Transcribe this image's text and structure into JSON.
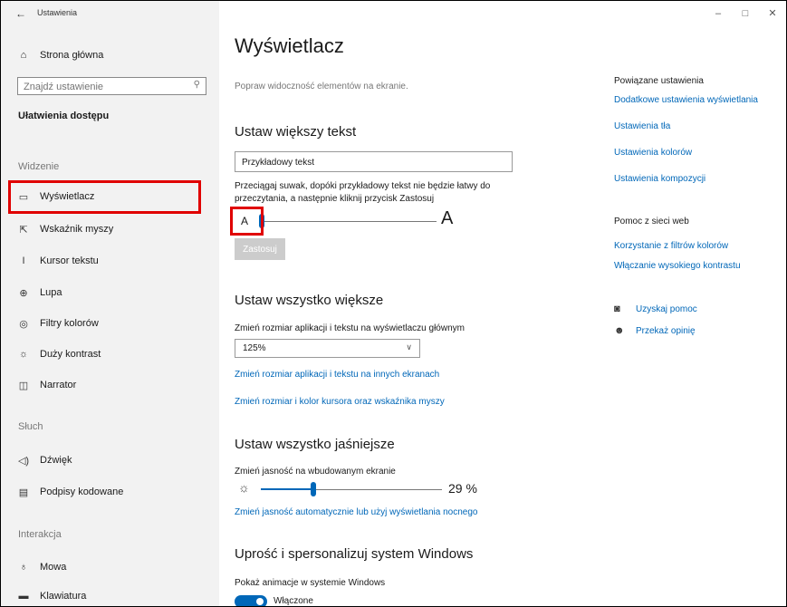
{
  "window": {
    "title": "Ustawienia",
    "back": "←",
    "controls": [
      "–",
      "□",
      "✕"
    ]
  },
  "sidebar": {
    "home": "Strona główna",
    "search_placeholder": "Znajdź ustawienie",
    "category": "Ułatwienia dostępu",
    "sections": {
      "vision": "Widzenie",
      "hearing": "Słuch",
      "interaction": "Interakcja"
    },
    "items": [
      {
        "label": "Wyświetlacz",
        "icon": "display-icon"
      },
      {
        "label": "Wskaźnik myszy",
        "icon": "mouse-pointer-icon"
      },
      {
        "label": "Kursor tekstu",
        "icon": "text-cursor-icon"
      },
      {
        "label": "Lupa",
        "icon": "magnifier-icon"
      },
      {
        "label": "Filtry kolorów",
        "icon": "color-filter-icon"
      },
      {
        "label": "Duży kontrast",
        "icon": "high-contrast-icon"
      },
      {
        "label": "Narrator",
        "icon": "narrator-icon"
      },
      {
        "label": "Dźwięk",
        "icon": "speaker-icon"
      },
      {
        "label": "Podpisy kodowane",
        "icon": "captions-icon"
      },
      {
        "label": "Mowa",
        "icon": "microphone-icon"
      },
      {
        "label": "Klawiatura",
        "icon": "keyboard-icon"
      }
    ]
  },
  "main": {
    "title": "Wyświetlacz",
    "subtitle": "Popraw widoczność elementów na ekranie.",
    "text_section": {
      "heading": "Ustaw większy tekst",
      "sample": "Przykładowy tekst",
      "instruction": "Przeciągaj suwak, dopóki przykładowy tekst nie będzie łatwy do przeczytania, a następnie kliknij przycisk Zastosuj",
      "small_a": "A",
      "big_a": "A",
      "slider_value_percent": 0,
      "apply": "Zastosuj"
    },
    "scale_section": {
      "heading": "Ustaw wszystko większe",
      "label": "Zmień rozmiar aplikacji i tekstu na wyświetlaczu głównym",
      "selected": "125%",
      "link1": "Zmień rozmiar aplikacji i tekstu na innych ekranach",
      "link2": "Zmień rozmiar i kolor kursora oraz wskaźnika myszy"
    },
    "brightness_section": {
      "heading": "Ustaw wszystko jaśniejsze",
      "label": "Zmień jasność na wbudowanym ekranie",
      "value": "29 %",
      "value_fraction": 0.29,
      "link": "Zmień jasność automatycznie lub użyj wyświetlania nocnego"
    },
    "personalize_section": {
      "heading": "Uprość i spersonalizuj system Windows",
      "animations_label": "Pokaż animacje w systemie Windows",
      "toggle_state": "Włączone"
    }
  },
  "related": {
    "title": "Powiązane ustawienia",
    "links": [
      "Dodatkowe ustawienia wyświetlania",
      "Ustawienia tła",
      "Ustawienia kolorów",
      "Ustawienia kompozycji"
    ],
    "help_title": "Pomoc z sieci web",
    "help_links": [
      "Korzystanie z filtrów kolorów",
      "Włączanie wysokiego kontrastu"
    ],
    "get_help": "Uzyskaj pomoc",
    "feedback": "Przekaż opinię"
  },
  "colors": {
    "accent": "#0067b8",
    "highlight": "#e00000",
    "sidebar_bg": "#f2f2f2"
  }
}
